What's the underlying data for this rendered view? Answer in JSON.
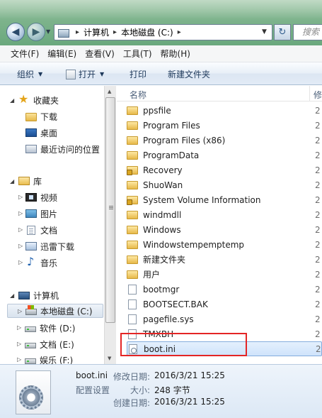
{
  "address": {
    "crumbs": [
      "计算机",
      "本地磁盘 (C:)"
    ],
    "search_placeholder": "搜索"
  },
  "menu": [
    "文件(F)",
    "编辑(E)",
    "查看(V)",
    "工具(T)",
    "帮助(H)"
  ],
  "commands": {
    "organize": "组织",
    "open": "打开",
    "print": "打印",
    "new_folder": "新建文件夹"
  },
  "nav": {
    "favorites": "收藏夹",
    "downloads": "下载",
    "desktop": "桌面",
    "recent": "最近访问的位置",
    "libraries": "库",
    "videos": "视频",
    "pictures": "图片",
    "documents": "文档",
    "thunder": "迅雷下载",
    "music": "音乐",
    "computer": "计算机",
    "drive_c": "本地磁盘 (C:)",
    "drive_d": "软件 (D:)",
    "drive_e": "文档 (E:)",
    "drive_f": "娱乐 (F:)"
  },
  "columns": {
    "name": "名称",
    "modified": "修"
  },
  "files": [
    {
      "name": "ppsfile",
      "type": "folder",
      "date": "2"
    },
    {
      "name": "Program Files",
      "type": "folder",
      "date": "2"
    },
    {
      "name": "Program Files (x86)",
      "type": "folder",
      "date": "2"
    },
    {
      "name": "ProgramData",
      "type": "folder",
      "date": "2"
    },
    {
      "name": "Recovery",
      "type": "folder-locked",
      "date": "2"
    },
    {
      "name": "ShuoWan",
      "type": "folder",
      "date": "2"
    },
    {
      "name": "System Volume Information",
      "type": "folder-locked",
      "date": "2"
    },
    {
      "name": "windmdll",
      "type": "folder",
      "date": "2"
    },
    {
      "name": "Windows",
      "type": "folder",
      "date": "2"
    },
    {
      "name": "Windowstempemptemp",
      "type": "folder",
      "date": "2"
    },
    {
      "name": "新建文件夹",
      "type": "folder",
      "date": "2"
    },
    {
      "name": "用户",
      "type": "folder",
      "date": "2"
    },
    {
      "name": "bootmgr",
      "type": "file",
      "date": "2"
    },
    {
      "name": "BOOTSECT.BAK",
      "type": "file",
      "date": "2"
    },
    {
      "name": "pagefile.sys",
      "type": "file",
      "date": "2"
    },
    {
      "name": "TMXBH",
      "type": "file",
      "date": "2"
    },
    {
      "name": "boot.ini",
      "type": "config",
      "date": "2"
    }
  ],
  "details": {
    "name": "boot.ini",
    "type": "配置设置",
    "modified_label": "修改日期:",
    "modified_value": "2016/3/21 15:25",
    "size_label": "大小:",
    "size_value": "248 字节",
    "created_label": "创建日期:",
    "created_value": "2016/3/21 15:25"
  },
  "colors": {
    "highlight_box": "#e42525",
    "selection": "#cfe3fb"
  }
}
